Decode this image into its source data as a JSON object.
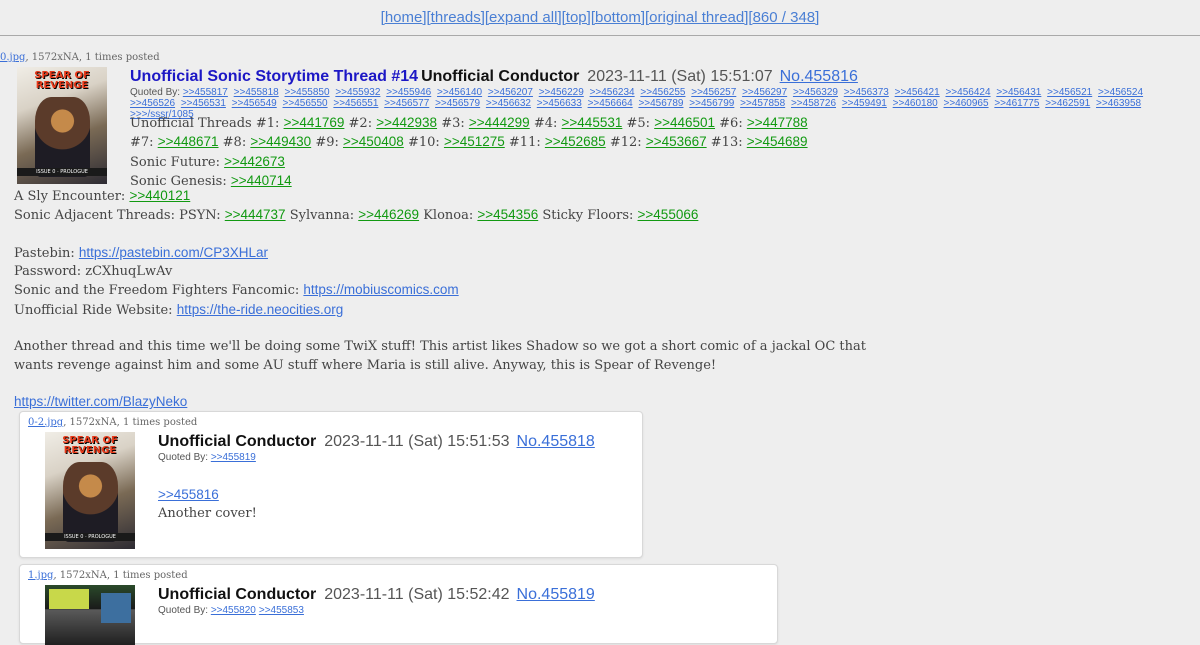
{
  "nav": {
    "home": "[home]",
    "threads": "[threads]",
    "expand_all": "[expand all]",
    "top": "[top]",
    "bottom": "[bottom]",
    "original_thread": "[original thread]",
    "count": "[860 / 348]"
  },
  "op": {
    "file_link": "0.jpg",
    "file_meta": ", 1572xNA, 1 times posted",
    "thumb_title": "SPEAR OF REVENGE",
    "thumb_caption": "ISSUE 0 · PROLOGUE",
    "title": "Unofficial Sonic Storytime Thread #14",
    "name": "Unofficial Conductor",
    "date": "2023-11-11 (Sat) 15:51:07",
    "number": "No.455816",
    "quoted_by_label": "Quoted By:",
    "quoted_by": [
      ">>455817",
      ">>455818",
      ">>455850",
      ">>455932",
      ">>455946",
      ">>456140",
      ">>456207",
      ">>456229",
      ">>456234",
      ">>456255",
      ">>456257",
      ">>456297",
      ">>456329",
      ">>456373",
      ">>456421",
      ">>456424",
      ">>456431",
      ">>456521",
      ">>456524",
      ">>456526",
      ">>456531",
      ">>456549",
      ">>456550",
      ">>456551",
      ">>456577",
      ">>456579",
      ">>456632",
      ">>456633",
      ">>456664",
      ">>456789",
      ">>456799",
      ">>457858",
      ">>458726",
      ">>459491",
      ">>460180",
      ">>460965",
      ">>461775",
      ">>462591",
      ">>463958",
      ">>>/sssr/1085"
    ],
    "threads_label": "Unofficial Threads",
    "threads": [
      {
        "n": "#1:",
        "ref": ">>441769"
      },
      {
        "n": "#2:",
        "ref": ">>442938"
      },
      {
        "n": "#3:",
        "ref": ">>444299"
      },
      {
        "n": "#4:",
        "ref": ">>445531"
      },
      {
        "n": "#5:",
        "ref": ">>446501"
      },
      {
        "n": "#6:",
        "ref": ">>447788"
      },
      {
        "n": "#7:",
        "ref": ">>448671"
      },
      {
        "n": "#8:",
        "ref": ">>449430"
      },
      {
        "n": "#9:",
        "ref": ">>450408"
      },
      {
        "n": "#10:",
        "ref": ">>451275"
      },
      {
        "n": "#11:",
        "ref": ">>452685"
      },
      {
        "n": "#12:",
        "ref": ">>453667"
      },
      {
        "n": "#13:",
        "ref": ">>454689"
      }
    ],
    "future_label": "Sonic Future:",
    "future_ref": ">>442673",
    "genesis_label": "Sonic Genesis:",
    "genesis_ref": ">>440714",
    "sly_label": "A Sly Encounter:",
    "sly_ref": ">>440121",
    "adjacent_label": "Sonic Adjacent Threads: PSYN:",
    "psyn_ref": ">>444737",
    "sylvanna_label": "Sylvanna:",
    "sylvanna_ref": ">>446269",
    "klonoa_label": "Klonoa:",
    "klonoa_ref": ">>454356",
    "sticky_label": "Sticky Floors:",
    "sticky_ref": ">>455066",
    "pastebin_label": "Pastebin:",
    "pastebin_url": "https://pastebin.com/CP3XHLar",
    "password_line": "Password: zCXhuqLwAv",
    "fancomic_label": "Sonic and the Freedom Fighters Fancomic:",
    "fancomic_url": "https://mobiuscomics.com",
    "ride_label": "Unofficial Ride Website:",
    "ride_url": "https://the-ride.neocities.org",
    "para1": "Another thread and this time we'll be doing some TwiX stuff! This artist likes Shadow so we got a short comic of a jackal OC that",
    "para2": "wants revenge against him and some AU stuff where Maria is still alive. Anyway, this is Spear of Revenge!",
    "twitter_url": "https://twitter.com/BlazyNeko"
  },
  "replies": [
    {
      "file_link": "0-2.jpg",
      "file_meta": ", 1572xNA, 1 times posted",
      "thumb_title": "SPEAR OF REVENGE",
      "thumb_caption": "ISSUE 0 · PROLOGUE",
      "name": "Unofficial Conductor",
      "date": "2023-11-11 (Sat) 15:51:53",
      "number": "No.455818",
      "quoted_by_label": "Quoted By:",
      "quoted_by": [
        ">>455819"
      ],
      "quote": ">>455816",
      "text": "Another cover!"
    },
    {
      "file_link": "1.jpg",
      "file_meta": ", 1572xNA, 1 times posted",
      "name": "Unofficial Conductor",
      "date": "2023-11-11 (Sat) 15:52:42",
      "number": "No.455819",
      "quoted_by_label": "Quoted By:",
      "quoted_by": [
        ">>455820",
        ">>455853"
      ]
    }
  ]
}
